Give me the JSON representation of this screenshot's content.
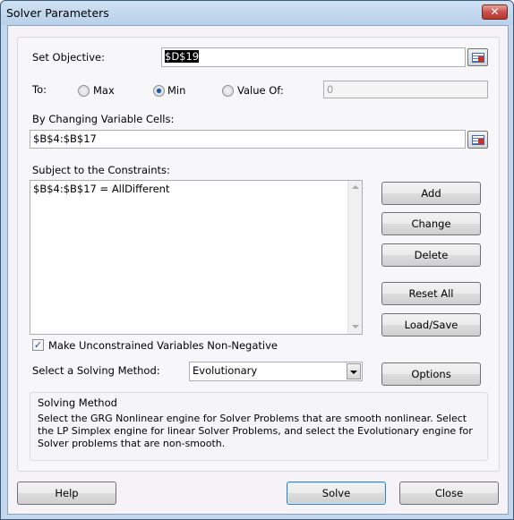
{
  "window": {
    "title": "Solver Parameters",
    "close_label": "✕"
  },
  "objective": {
    "label": "Set Objective:",
    "value": "$D$19"
  },
  "to": {
    "label": "To:",
    "options": [
      {
        "label": "Max",
        "selected": false
      },
      {
        "label": "Min",
        "selected": true
      },
      {
        "label": "Value Of:",
        "selected": false
      }
    ],
    "value_of": "0"
  },
  "changing": {
    "label": "By Changing Variable Cells:",
    "value": "$B$4:$B$17"
  },
  "constraints": {
    "label": "Subject to the Constraints:",
    "items": [
      "$B$4:$B$17 = AllDifferent"
    ]
  },
  "buttons": {
    "add": "Add",
    "change": "Change",
    "delete": "Delete",
    "reset_all": "Reset All",
    "load_save": "Load/Save",
    "options": "Options",
    "help": "Help",
    "solve": "Solve",
    "close": "Close"
  },
  "nonneg": {
    "label": "Make Unconstrained Variables Non-Negative",
    "checked": true
  },
  "method": {
    "label": "Select a Solving Method:",
    "value": "Evolutionary"
  },
  "info": {
    "title": "Solving Method",
    "text": "Select the GRG Nonlinear engine for Solver Problems that are smooth nonlinear. Select the LP Simplex engine for linear Solver Problems, and select the Evolutionary engine for Solver problems that are non-smooth."
  }
}
